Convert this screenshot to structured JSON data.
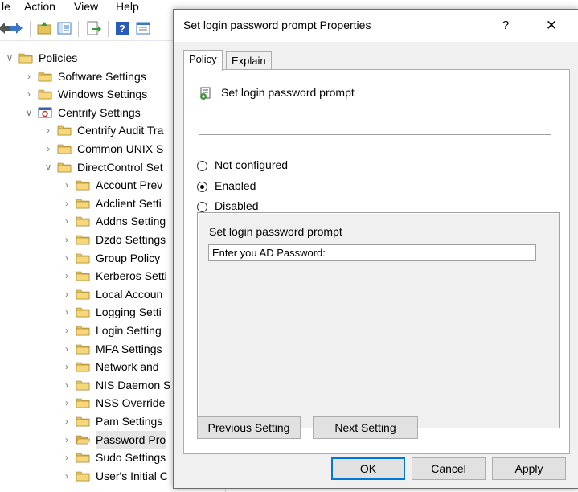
{
  "menubar": {
    "items": [
      "le",
      "Action",
      "View",
      "Help"
    ]
  },
  "tree": {
    "items": [
      {
        "label": "Policies",
        "expanded": true,
        "level": 0,
        "icon": "folder-icon"
      },
      {
        "label": "Software Settings",
        "expanded": false,
        "level": 1,
        "icon": "folder-icon"
      },
      {
        "label": "Windows Settings",
        "expanded": false,
        "level": 1,
        "icon": "folder-icon"
      },
      {
        "label": "Centrify Settings",
        "expanded": true,
        "level": 1,
        "icon": "centrify-icon"
      },
      {
        "label": "Centrify Audit Tra",
        "expanded": false,
        "level": 2,
        "icon": "folder-icon"
      },
      {
        "label": "Common UNIX S",
        "expanded": false,
        "level": 2,
        "icon": "folder-icon"
      },
      {
        "label": "DirectControl Set",
        "expanded": true,
        "level": 2,
        "icon": "folder-icon"
      },
      {
        "label": "Account Prev",
        "expanded": false,
        "level": 3,
        "icon": "folder-icon"
      },
      {
        "label": "Adclient Setti",
        "expanded": false,
        "level": 3,
        "icon": "folder-icon"
      },
      {
        "label": "Addns Setting",
        "expanded": false,
        "level": 3,
        "icon": "folder-icon"
      },
      {
        "label": "Dzdo Settings",
        "expanded": false,
        "level": 3,
        "icon": "folder-icon"
      },
      {
        "label": "Group Policy",
        "expanded": false,
        "level": 3,
        "icon": "folder-icon"
      },
      {
        "label": "Kerberos Setti",
        "expanded": false,
        "level": 3,
        "icon": "folder-icon"
      },
      {
        "label": "Local Accoun",
        "expanded": false,
        "level": 3,
        "icon": "folder-icon"
      },
      {
        "label": "Logging Setti",
        "expanded": false,
        "level": 3,
        "icon": "folder-icon"
      },
      {
        "label": "Login Setting",
        "expanded": false,
        "level": 3,
        "icon": "folder-icon"
      },
      {
        "label": "MFA Settings",
        "expanded": false,
        "level": 3,
        "icon": "folder-icon"
      },
      {
        "label": "Network and",
        "expanded": false,
        "level": 3,
        "icon": "folder-icon"
      },
      {
        "label": "NIS Daemon S",
        "expanded": false,
        "level": 3,
        "icon": "folder-icon"
      },
      {
        "label": "NSS Override",
        "expanded": false,
        "level": 3,
        "icon": "folder-icon"
      },
      {
        "label": "Pam Settings",
        "expanded": false,
        "level": 3,
        "icon": "folder-icon"
      },
      {
        "label": "Password Pro",
        "expanded": false,
        "level": 3,
        "icon": "open-folder-icon",
        "selected": true
      },
      {
        "label": "Sudo Settings",
        "expanded": false,
        "level": 3,
        "icon": "folder-icon"
      },
      {
        "label": "User's Initial C",
        "expanded": false,
        "level": 3,
        "icon": "folder-icon"
      }
    ]
  },
  "dialog": {
    "title": "Set login password prompt Properties",
    "help_label": "?",
    "close_label": "✕",
    "tabs": [
      {
        "label": "Policy",
        "active": true
      },
      {
        "label": "Explain",
        "active": false
      }
    ],
    "policy_name": "Set login password prompt",
    "radios": [
      {
        "label": "Not configured",
        "checked": false
      },
      {
        "label": "Enabled",
        "checked": true
      },
      {
        "label": "Disabled",
        "checked": false
      }
    ],
    "option_label": "Set login password prompt",
    "option_value": "Enter you AD Password:",
    "prev_button": "Previous Setting",
    "next_button": "Next Setting",
    "ok_button": "OK",
    "cancel_button": "Cancel",
    "apply_button": "Apply"
  },
  "colors": {
    "accent": "#0078d7",
    "folder": "#e8c25c",
    "dialog_bg": "#f0f0f0"
  }
}
